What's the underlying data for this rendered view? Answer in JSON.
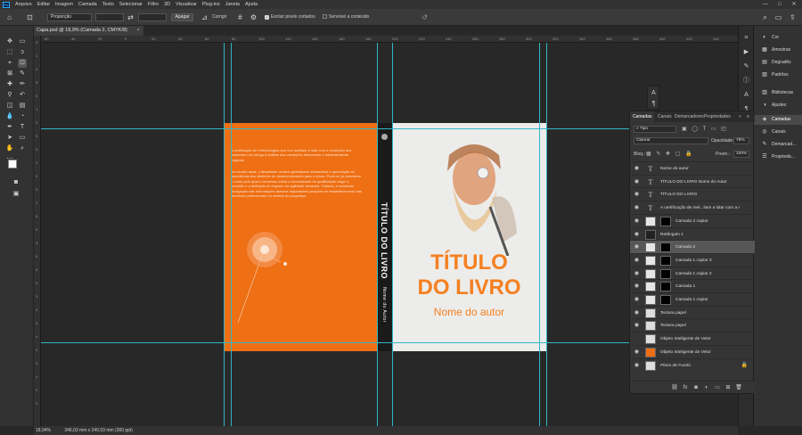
{
  "app": {
    "logo_text": "Ps"
  },
  "menu": [
    "Arquivo",
    "Editar",
    "Imagem",
    "Camada",
    "Texto",
    "Selecionar",
    "Filtro",
    "3D",
    "Visualizar",
    "Plug-ins",
    "Janela",
    "Ajuda"
  ],
  "window_controls": {
    "minimize": "—",
    "maximize": "□",
    "close": "✕"
  },
  "options_bar": {
    "ratio_select": "Proporção",
    "clear_button": "Apagar",
    "straighten_label": "Corrigir",
    "delete_cropped_label": "Excluir pixels cortados",
    "content_aware_label": "Sensível a conteúdo",
    "reset_icon": "↺"
  },
  "document_tab": {
    "title": "Capa.psd @ 18,9% (Camada 2, CMYK/8)",
    "close": "×"
  },
  "rulers": {
    "h_ticks": [
      "60",
      "40",
      "20",
      "0",
      "20",
      "40",
      "60",
      "80",
      "100",
      "120",
      "140",
      "160",
      "180",
      "200",
      "220",
      "240",
      "260",
      "280",
      "300",
      "320",
      "340",
      "360",
      "380",
      "400",
      "420",
      "440"
    ],
    "v_ticks": [
      "0",
      "1",
      "0",
      "5",
      "0",
      "1",
      "0",
      "5",
      "0",
      "2",
      "0",
      "0",
      "2",
      "5",
      "0",
      "3",
      "0",
      "5",
      "0",
      "3",
      "0",
      "5",
      "4",
      "0",
      "0",
      "4",
      "0",
      "0"
    ]
  },
  "cover": {
    "back_paragraph_1": "A certificação de metodologias que nos auxiliam a lidar com a revolução dos costumes nos obriga à análise das condições financeiras e administrativas exigidas.",
    "back_paragraph_2": "No mundo atual, o desafiador cenário globalizado obstaculiza a apreciação da importância dos diretores de desenvolvimento para o futuro. Pode-se já vislumbrar o modo pelo qual o consenso sobre a necessidade de qualificação exige a precisão e a definição do impacto na agilidade decisória. Todavia, a constante divulgação das informações assume importantes posições no estabelecimento das diretrizes preferenciais no sentido do progresso.",
    "spine_title": "TÍTULO DO LIVRO",
    "spine_author": "Nome do Autor",
    "front_title_line1": "TÍTULO",
    "front_title_line2": "DO LIVRO",
    "front_author": "Nome do autor"
  },
  "status_bar": {
    "zoom": "18,94%",
    "doc_size": "346,03 mm x 240,03 mm (300 ppi)"
  },
  "right_dock": [
    "Cor",
    "Amostras",
    "Degradês",
    "Padrões",
    "Bibliotecas",
    "Ajustes",
    "Camadas",
    "Canais",
    "Demarcad...",
    "Propriedа..."
  ],
  "layers_panel": {
    "tabs": [
      "Camadas",
      "Canais",
      "Demarcadores",
      "Propriedades"
    ],
    "kind_filter": "Tipo",
    "blend_mode": "Clarear",
    "opacity_label": "Opacidade:",
    "opacity_value": "79%",
    "lock_label": "Bloq.:",
    "fill_label": "Preen.:",
    "fill_value": "100%",
    "layers": [
      {
        "name": "Nome do autor",
        "type": "text",
        "selected": false
      },
      {
        "name": "TÍTULO DO LIVRO Nome do Autor",
        "type": "text",
        "selected": false
      },
      {
        "name": "TÍTULO  DO LIVRO",
        "type": "text",
        "selected": false
      },
      {
        "name": "A certificação de met...liam a lidar com a r",
        "type": "text",
        "selected": false
      },
      {
        "name": "Camada 2 copiar",
        "type": "mask",
        "selected": false
      },
      {
        "name": "Retângulo 1",
        "type": "shape",
        "selected": false
      },
      {
        "name": "Camada 2",
        "type": "mask",
        "selected": true
      },
      {
        "name": "Camada 1 copiar 3",
        "type": "mask",
        "selected": false
      },
      {
        "name": "Camada 1 copiar 2",
        "type": "mask",
        "selected": false
      },
      {
        "name": "Camada 1",
        "type": "mask",
        "selected": false
      },
      {
        "name": "Camada 1 copiar",
        "type": "mask",
        "selected": false
      },
      {
        "name": "Textura papel",
        "type": "pixel",
        "selected": false
      },
      {
        "name": "Textura papel",
        "type": "pixel",
        "selected": false
      },
      {
        "name": "Objeto Inteligente de Vetor",
        "type": "smart",
        "selected": false
      },
      {
        "name": "Objeto Inteligente de Vetor",
        "type": "smart-orange",
        "selected": false
      },
      {
        "name": "Plano de Fundo",
        "type": "background",
        "selected": false
      }
    ]
  },
  "colors": {
    "accent_orange": "#ee6f14",
    "title_orange": "#f58021",
    "guide": "#2fb7c6"
  }
}
